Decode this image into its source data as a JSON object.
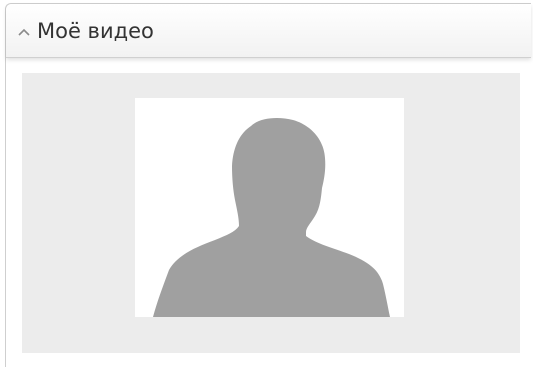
{
  "panel": {
    "title": "Моё видео",
    "collapse_icon": "chevron-up-icon"
  },
  "video": {
    "placeholder_icon": "person-silhouette-icon",
    "colors": {
      "area_background": "#ececec",
      "frame_background": "#ffffff",
      "silhouette": "#a0a0a0"
    }
  }
}
